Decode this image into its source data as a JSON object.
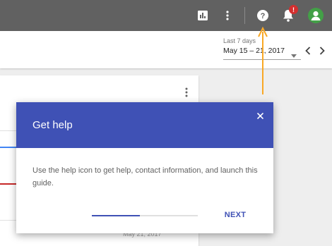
{
  "topbar": {
    "icons": [
      "bar-chart-icon",
      "more-vert-icon",
      "help-icon",
      "notifications-icon",
      "account-icon"
    ],
    "notification_badge": "!"
  },
  "date_range": {
    "caption": "Last 7 days",
    "value": "May 15 – 21, 2017"
  },
  "card": {
    "footer_date": "May 21, 2017"
  },
  "dialog": {
    "title": "Get help",
    "body": "Use the help icon to get help, contact information, and launch this guide.",
    "next_label": "NEXT",
    "progress_fraction": 0.45
  },
  "colors": {
    "topbar": "#616161",
    "accent": "#3f51b5",
    "pointer_arrow": "#f9a825",
    "badge": "#d32f2f",
    "avatar": "#43a047",
    "chart_blue": "#4285f4",
    "chart_red": "#c62828"
  }
}
